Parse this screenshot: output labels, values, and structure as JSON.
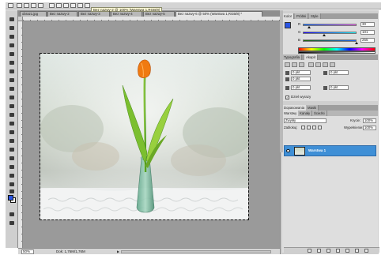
{
  "app": {
    "tooltip": "Bez nazwy-2 @ 100% (Warstwa 1,RGB/8)"
  },
  "tabs": [
    {
      "label": "obraz1.jpg"
    },
    {
      "label": "Bez nazwy-2"
    },
    {
      "label": "Bez nazwy-3"
    },
    {
      "label": "Bez nazwy-4"
    },
    {
      "label": "Bez nazwy-5"
    },
    {
      "label": "Bez nazwy-6 @ 50% (Warstwa 1,RGB/8) *"
    }
  ],
  "statusbar": {
    "zoom": "50%",
    "doc": "Dok: 1,76M/1,76M"
  },
  "color_panel": {
    "tabs": [
      "Kolor",
      "Próbki",
      "Style"
    ],
    "rows": [
      {
        "label": "R",
        "value": "30",
        "level": 0.12
      },
      {
        "label": "G",
        "value": "101",
        "level": 0.4
      },
      {
        "label": "B",
        "value": "255",
        "level": 1.0
      }
    ],
    "fg_color": "#2a55e4"
  },
  "char_panel": {
    "tabs": [
      "Typografia",
      "Akapit"
    ],
    "fields": [
      "0 pkt",
      "0 pkt",
      "0 pkt",
      "0 pkt",
      "0 pkt"
    ],
    "hyphen_label": "Dziel wyrazy"
  },
  "layers": {
    "outer_tabs": [
      "Dopasowania",
      "Maski"
    ],
    "inner_tabs": [
      "Warstwy",
      "Kanały",
      "Ścieżki"
    ],
    "blend_mode": "Zwykły",
    "opacity_label": "Krycie:",
    "opacity": "100%",
    "lock_label": "Zablokuj:",
    "fill_label": "Wypełnienie:",
    "fill": "100%",
    "layer_name": "Warstwa 1"
  },
  "colors": {
    "selection": "#3f8fd6",
    "foreground": "#2a55e4",
    "tulip": "#f07a10"
  }
}
